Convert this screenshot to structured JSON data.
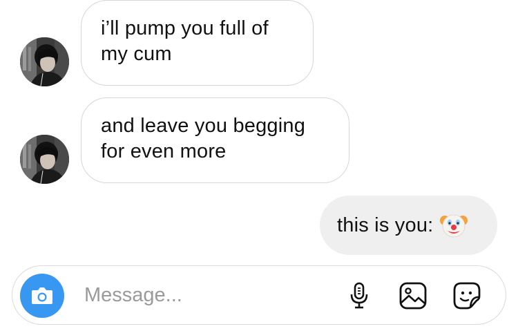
{
  "messages": [
    {
      "direction": "incoming",
      "avatar": "profile-photo",
      "lines": [
        "i’ll pump you full of",
        "my cum"
      ]
    },
    {
      "direction": "incoming",
      "avatar": "profile-photo",
      "lines": [
        "and leave you begging",
        "for even more"
      ]
    },
    {
      "direction": "outgoing",
      "text": "this is you:",
      "emoji": "clown-face"
    }
  ],
  "composer": {
    "placeholder": "Message...",
    "value": "",
    "icons": [
      "camera-icon",
      "microphone-icon",
      "gallery-icon",
      "sticker-icon"
    ],
    "camera_color": "#3897f0"
  },
  "colors": {
    "incoming_border": "#d6d6d6",
    "outgoing_bubble": "#efefef",
    "placeholder": "#9a9a9a"
  }
}
